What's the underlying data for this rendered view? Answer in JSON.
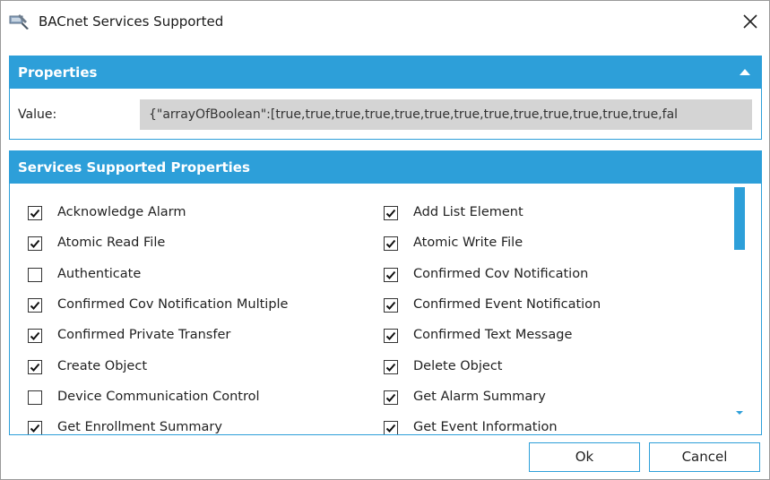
{
  "window": {
    "title": "BACnet Services Supported"
  },
  "properties": {
    "header": "Properties",
    "value_label": "Value:",
    "value": "{\"arrayOfBoolean\":[true,true,true,true,true,true,true,true,true,true,true,true,true,fal"
  },
  "services": {
    "header": "Services Supported Properties",
    "left": [
      {
        "label": "Acknowledge Alarm",
        "checked": true
      },
      {
        "label": "Atomic Read File",
        "checked": true
      },
      {
        "label": "Authenticate",
        "checked": false
      },
      {
        "label": "Confirmed Cov Notification Multiple",
        "checked": true
      },
      {
        "label": "Confirmed Private Transfer",
        "checked": true
      },
      {
        "label": "Create Object",
        "checked": true
      },
      {
        "label": "Device Communication Control",
        "checked": false
      },
      {
        "label": "Get Enrollment Summary",
        "checked": true
      }
    ],
    "right": [
      {
        "label": "Add List Element",
        "checked": true
      },
      {
        "label": "Atomic Write File",
        "checked": true
      },
      {
        "label": "Confirmed Cov Notification",
        "checked": true
      },
      {
        "label": "Confirmed Event Notification",
        "checked": true
      },
      {
        "label": "Confirmed Text Message",
        "checked": true
      },
      {
        "label": "Delete Object",
        "checked": true
      },
      {
        "label": "Get Alarm Summary",
        "checked": true
      },
      {
        "label": "Get Event Information",
        "checked": true
      }
    ]
  },
  "buttons": {
    "ok": "Ok",
    "cancel": "Cancel"
  },
  "colors": {
    "accent": "#2d9fd9",
    "value_field_bg": "#d4d4d4"
  },
  "icons": {
    "app": "bacnet-tool-icon",
    "close": "close-icon",
    "collapse": "collapse-up-icon"
  }
}
